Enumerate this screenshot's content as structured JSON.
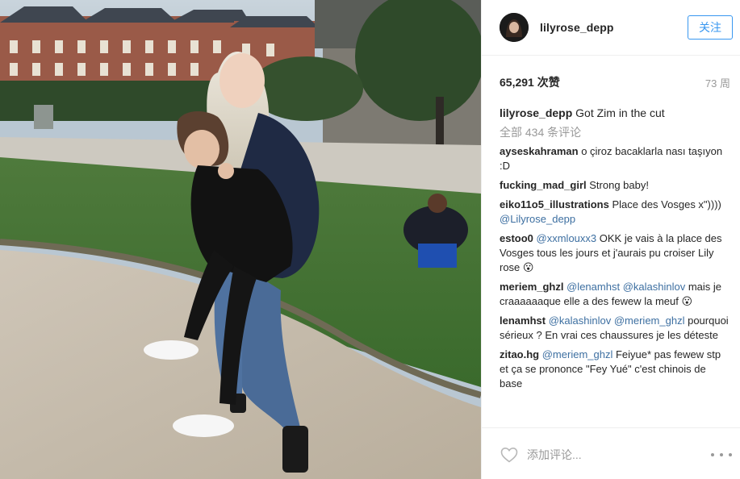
{
  "colors": {
    "accent": "#3897f0",
    "text": "#262626",
    "muted": "#999999",
    "link": "#3d6fa1"
  },
  "post": {
    "image_alt": "photo",
    "icon_more": "more-dots-icon"
  },
  "header": {
    "username": "lilyrose_depp",
    "follow_label": "关注"
  },
  "meta": {
    "likes": "65,291 次赞",
    "time_ago": "73 周"
  },
  "caption": {
    "user": "lilyrose_depp",
    "text": "Got Zim in the cut"
  },
  "view_all": "全部 434 条评论",
  "comments": [
    {
      "user": "ayseskahraman",
      "text": "o çiroz bacaklarla nası taşıyon :D"
    },
    {
      "user": "fucking_mad_girl",
      "text": "Strong baby!"
    },
    {
      "user": "eiko11o5_illustrations",
      "text": "Place des Vosges x\")))) ",
      "mention": "@Lilyrose_depp"
    },
    {
      "user": "estoo0",
      "mention": "@xxmlouxx3",
      "text": "OKK je vais à la place des Vosges tous les jours et j'aurais pu croiser Lily rose 😮"
    },
    {
      "user": "meriem_ghzl",
      "mention": "@lenamhst",
      "mention2": "@kalashinlov",
      "text": "mais je craaaaaaque elle a des fewew la meuf 😮"
    },
    {
      "user": "lenamhst",
      "mention": "@kalashinlov",
      "mention2": "@meriem_ghzl",
      "text": "pourquoi sérieux ? En vrai ces chaussures je les déteste"
    },
    {
      "user": "zitao.hg",
      "mention": "@meriem_ghzl",
      "text": "Feiyue* pas fewew stp et ça se prononce \"Fey Yué\" c'est chinois de base"
    }
  ],
  "add_comment": {
    "placeholder": "添加评论..."
  }
}
